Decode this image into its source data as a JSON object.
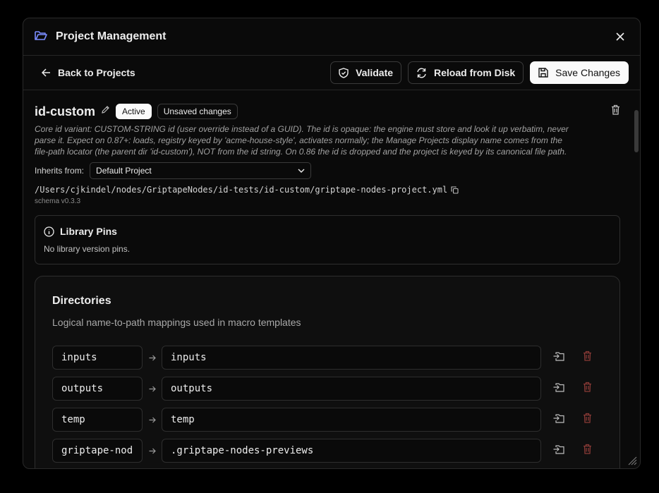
{
  "header": {
    "title": "Project Management",
    "folder_icon": "folder-open-icon",
    "close_icon": "close-icon"
  },
  "toolbar": {
    "back_label": "Back to Projects",
    "validate_label": "Validate",
    "reload_label": "Reload from Disk",
    "save_label": "Save Changes"
  },
  "project": {
    "name": "id-custom",
    "badge_active": "Active",
    "badge_unsaved": "Unsaved changes",
    "description": "Core id variant: CUSTOM-STRING id (user override instead of a GUID). The id is opaque: the engine must store and look it up verbatim, never parse it. Expect on 0.87+: loads, registry keyed by 'acme-house-style', activates normally; the Manage Projects display name comes from the file-path locator (the parent dir 'id-custom'), NOT from the id string. On 0.86 the id is dropped and the project is keyed by its canonical file path.",
    "inherits_label": "Inherits from:",
    "inherits_value": "Default Project",
    "path": "/Users/cjkindel/nodes/GriptapeNodes/id-tests/id-custom/griptape-nodes-project.yml",
    "schema": "schema v0.3.3"
  },
  "pins": {
    "title": "Library Pins",
    "empty_text": "No library version pins."
  },
  "directories": {
    "title": "Directories",
    "description": "Logical name-to-path mappings used in macro templates",
    "rows": [
      {
        "name": "inputs",
        "path": "inputs"
      },
      {
        "name": "outputs",
        "path": "outputs"
      },
      {
        "name": "temp",
        "path": "temp"
      },
      {
        "name": "griptape-nod",
        "path": ".griptape-nodes-previews"
      }
    ]
  },
  "colors": {
    "accent_blue": "#7b8cff",
    "danger": "#8a3a36",
    "primary_bg": "#fafafa"
  }
}
